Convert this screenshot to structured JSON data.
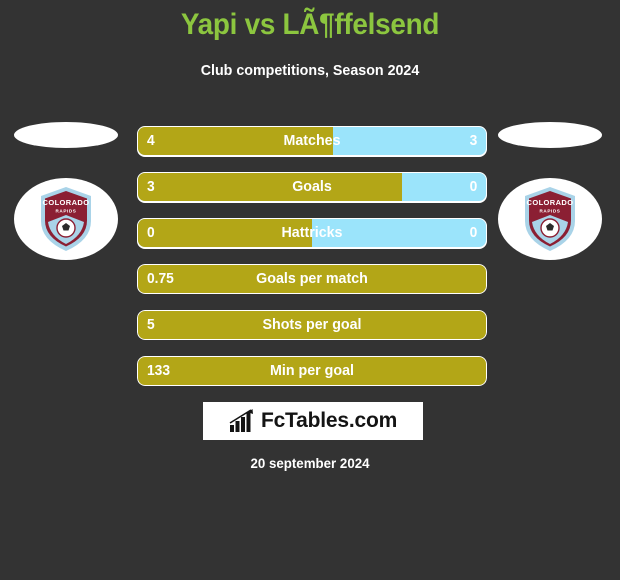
{
  "header": {
    "title": "Yapi vs LÃ¶ffelsend",
    "subtitle": "Club competitions, Season 2024"
  },
  "colors": {
    "background": "#333333",
    "title": "#8CC63F",
    "home_bar": "#B3A617",
    "away_bar": "#9BE4FB",
    "text": "#ffffff",
    "crest_primary": "#8B1F33",
    "crest_secondary": "#A9D3E8"
  },
  "teams": {
    "home": {
      "crest_name": "Colorado Rapids",
      "crest_text_top": "COLORADO",
      "crest_text_bottom": "RAPIDS"
    },
    "away": {
      "crest_name": "Colorado Rapids",
      "crest_text_top": "COLORADO",
      "crest_text_bottom": "RAPIDS"
    }
  },
  "stats": [
    {
      "label": "Matches",
      "home": "4",
      "away": "3",
      "home_pct": 56,
      "split": true
    },
    {
      "label": "Goals",
      "home": "3",
      "away": "0",
      "home_pct": 76,
      "split": true
    },
    {
      "label": "Hattricks",
      "home": "0",
      "away": "0",
      "home_pct": 50,
      "split": true
    },
    {
      "label": "Goals per match",
      "home": "0.75",
      "away": "",
      "home_pct": 100,
      "split": false
    },
    {
      "label": "Shots per goal",
      "home": "5",
      "away": "",
      "home_pct": 100,
      "split": false
    },
    {
      "label": "Min per goal",
      "home": "133",
      "away": "",
      "home_pct": 100,
      "split": false
    }
  ],
  "footer": {
    "brand": "FcTables.com",
    "brand_icon": "bar-chart-growth-icon",
    "date": "20 september 2024"
  },
  "chart_data": {
    "type": "bar",
    "title": "Yapi vs LÃ¶ffelsend",
    "subtitle": "Club competitions, Season 2024",
    "categories": [
      "Matches",
      "Goals",
      "Hattricks",
      "Goals per match",
      "Shots per goal",
      "Min per goal"
    ],
    "series": [
      {
        "name": "Yapi",
        "values": [
          4,
          3,
          0,
          0.75,
          5,
          133
        ]
      },
      {
        "name": "LÃ¶ffelsend",
        "values": [
          3,
          0,
          0,
          null,
          null,
          null
        ]
      }
    ],
    "legend": "none",
    "grid": false
  }
}
